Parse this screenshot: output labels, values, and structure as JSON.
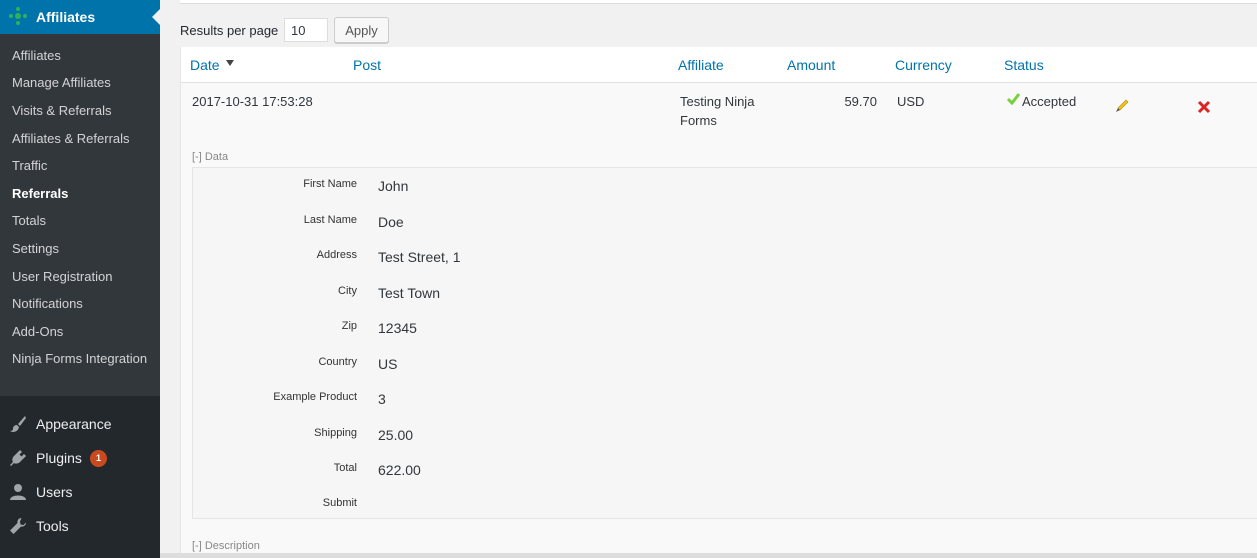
{
  "sidebar": {
    "header": "Affiliates",
    "submenu": [
      "Affiliates",
      "Manage Affiliates",
      "Visits & Referrals",
      "Affiliates & Referrals",
      "Traffic",
      "Referrals",
      "Totals",
      "Settings",
      "User Registration",
      "Notifications",
      "Add-Ons",
      "Ninja Forms Integration"
    ],
    "current": "Referrals",
    "menu": [
      {
        "label": "Appearance",
        "icon": "paintbrush-icon"
      },
      {
        "label": "Plugins",
        "icon": "plugin-icon",
        "badge": "1"
      },
      {
        "label": "Users",
        "icon": "user-icon"
      },
      {
        "label": "Tools",
        "icon": "wrench-icon"
      }
    ]
  },
  "controls": {
    "results_per_page_label": "Results per page",
    "results_per_page_value": "10",
    "apply_label": "Apply"
  },
  "table": {
    "headers": [
      "Date",
      "Post",
      "Affiliate",
      "Amount",
      "Currency",
      "Status"
    ],
    "row": {
      "date": "2017-10-31 17:53:28",
      "post": "",
      "affiliate": "Testing Ninja Forms",
      "amount": "59.70",
      "currency": "USD",
      "status": "Accepted"
    },
    "data_toggle": "[-] Data",
    "description_toggle": "[-] Description",
    "data_fields": [
      {
        "label": "First Name",
        "value": "John"
      },
      {
        "label": "Last Name",
        "value": "Doe"
      },
      {
        "label": "Address",
        "value": "Test Street, 1"
      },
      {
        "label": "City",
        "value": "Test Town"
      },
      {
        "label": "Zip",
        "value": "12345"
      },
      {
        "label": "Country",
        "value": "US"
      },
      {
        "label": "Example Product",
        "value": "3"
      },
      {
        "label": "Shipping",
        "value": "25.00"
      },
      {
        "label": "Total",
        "value": "622.00"
      },
      {
        "label": "Submit",
        "value": ""
      }
    ]
  },
  "colors": {
    "sidebar_bg": "#23282d",
    "submenu_bg": "#32373c",
    "active": "#0073aa",
    "link": "#0073aa",
    "accepted_check": "#7ad03a",
    "delete": "#d00",
    "badge": "#ca4a1f"
  }
}
